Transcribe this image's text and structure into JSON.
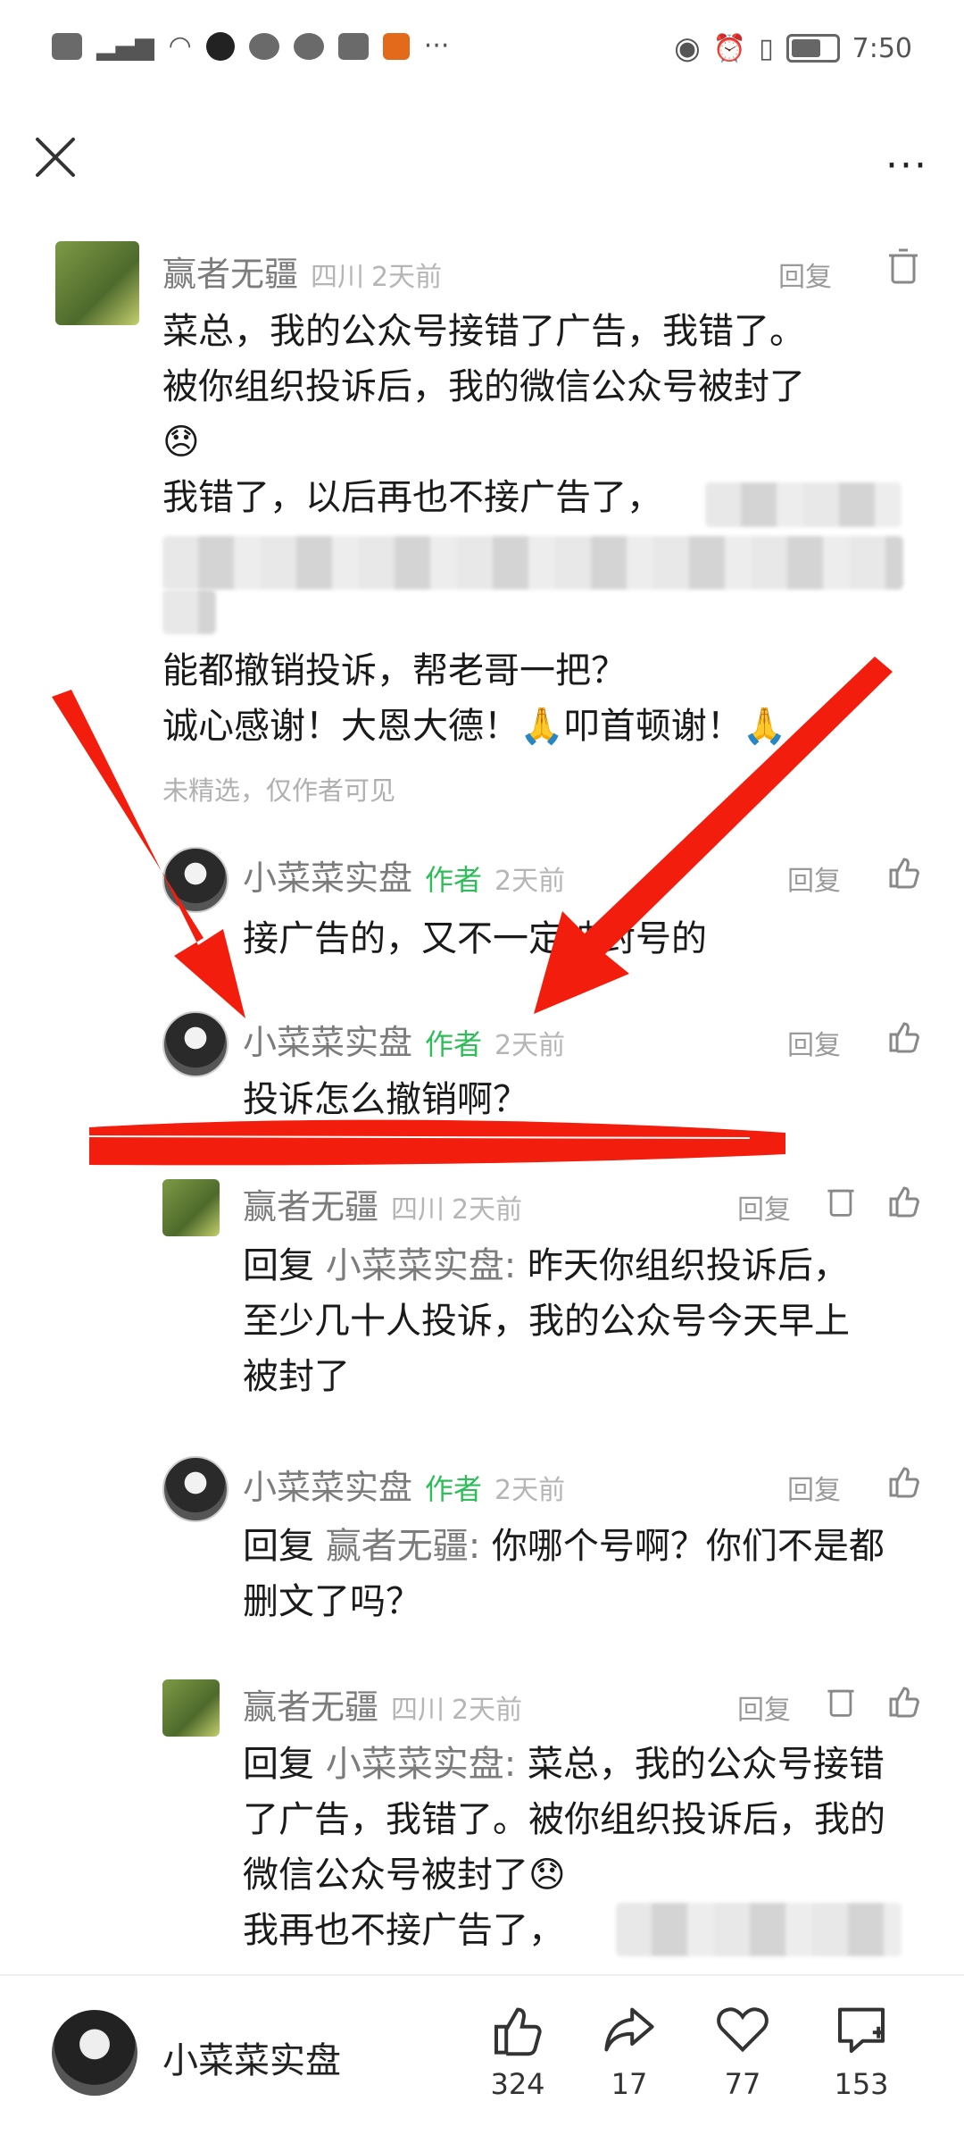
{
  "status_bar": {
    "time": "7:50",
    "dots": "···"
  },
  "header": {
    "more": "···"
  },
  "comments": [
    {
      "name": "赢者无疆",
      "location": "四川",
      "time": "2天前",
      "reply_label": "回复",
      "lines": [
        "菜总，我的公众号接错了广告，我错了。",
        "被你组织投诉后，我的微信公众号被封了",
        "😞",
        "我错了，以后再也不接广告了，",
        "能都撤销投诉，帮老哥一把？",
        "诚心感谢！大恩大德！🙏叩首顿谢！🙏"
      ],
      "note": "未精选，仅作者可见"
    }
  ],
  "replies": [
    {
      "name": "小菜菜实盘",
      "tag": "作者",
      "time": "2天前",
      "reply_label": "回复",
      "text": "接广告的，又不一定被封号的"
    },
    {
      "name": "小菜菜实盘",
      "tag": "作者",
      "time": "2天前",
      "reply_label": "回复",
      "text": "投诉怎么撤销啊？"
    },
    {
      "name": "赢者无疆",
      "location": "四川",
      "time": "2天前",
      "reply_label": "回复",
      "prefix": "回复",
      "target": "小菜菜实盘:",
      "text": "昨天你组织投诉后，至少几十人投诉，我的公众号今天早上被封了"
    },
    {
      "name": "小菜菜实盘",
      "tag": "作者",
      "time": "2天前",
      "reply_label": "回复",
      "prefix": "回复",
      "target": "赢者无疆:",
      "text": "你哪个号啊？你们不是都删文了吗？"
    },
    {
      "name": "赢者无疆",
      "location": "四川",
      "time": "2天前",
      "reply_label": "回复",
      "prefix": "回复",
      "target": "小菜菜实盘:",
      "text": "菜总，我的公众号接错了广告，我错了。被你组织投诉后，我的微信公众号被封了😞",
      "text2": "我再也不接广告了，"
    }
  ],
  "bottom_bar": {
    "author": "小菜菜实盘",
    "likes": "324",
    "shares": "17",
    "favorites": "77",
    "comments": "153"
  },
  "colors": {
    "annotation_red": "#f21d0c",
    "author_green": "#2dbe5a"
  }
}
